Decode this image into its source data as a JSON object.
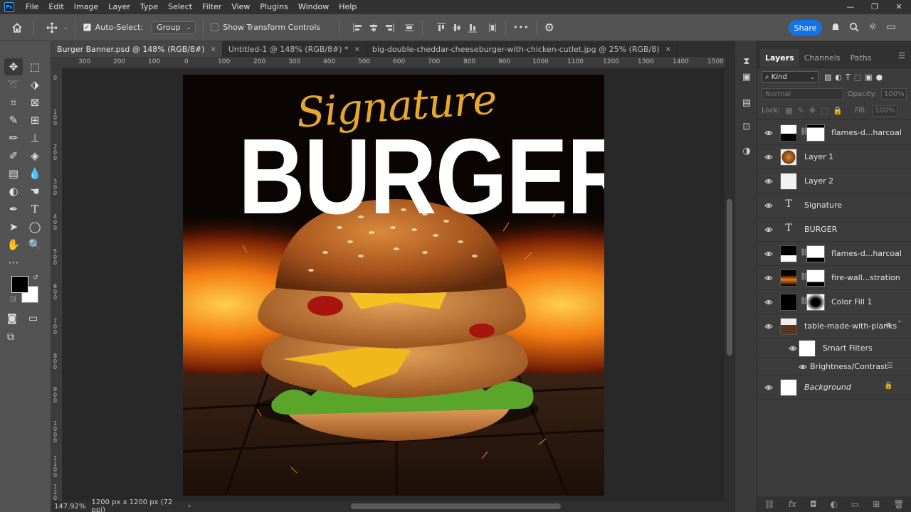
{
  "menu": [
    "File",
    "Edit",
    "Image",
    "Layer",
    "Type",
    "Select",
    "Filter",
    "View",
    "Plugins",
    "Window",
    "Help"
  ],
  "options": {
    "auto_select_label": "Auto-Select:",
    "group_select": "Group",
    "transform_label": "Show Transform Controls",
    "more_label": "•••",
    "share_label": "Share"
  },
  "tabs": [
    {
      "label": "Burger Banner.psd @ 148% (RGB/8#)",
      "active": true
    },
    {
      "label": "Untitled-1 @ 148% (RGB/8#) *",
      "active": false
    },
    {
      "label": "big-double-cheddar-cheeseburger-with-chicken-cutlet.jpg @ 25% (RGB/8)",
      "active": false
    }
  ],
  "ruler_h": [
    "300",
    "200",
    "100",
    "0",
    "100",
    "200",
    "300",
    "400",
    "500",
    "600",
    "700",
    "800",
    "900",
    "1000",
    "1100",
    "1200",
    "1300",
    "1400",
    "1500"
  ],
  "ruler_v": [
    "0",
    "100",
    "200",
    "300",
    "400",
    "500",
    "600",
    "700",
    "800",
    "900",
    "1000",
    "1100",
    "1200"
  ],
  "artwork": {
    "signature": "Signature",
    "headline": "BURGER"
  },
  "status": {
    "zoom": "147.92%",
    "doc_size": "1200 px x 1200 px (72 ppi)"
  },
  "panel": {
    "tabs": [
      "Layers",
      "Channels",
      "Paths"
    ],
    "kind_label": "Kind",
    "blend_mode": "Normal",
    "opacity_label": "Opacity:",
    "opacity_value": "100%",
    "lock_label": "Lock:",
    "fill_label": "Fill:",
    "fill_value": "100%"
  },
  "layers": [
    {
      "name": "flames-d...harcoal",
      "type": "smart-mask"
    },
    {
      "name": "Layer 1",
      "type": "smart"
    },
    {
      "name": "Layer 2",
      "type": "pixel"
    },
    {
      "name": "Signature",
      "type": "text"
    },
    {
      "name": "BURGER",
      "type": "text"
    },
    {
      "name": "flames-d...harcoal",
      "type": "smart-mask"
    },
    {
      "name": "fire-wall...stration",
      "type": "smart-mask"
    },
    {
      "name": "Color Fill 1",
      "type": "fill-mask"
    },
    {
      "name": "table-made-with-planks",
      "type": "smart-filters"
    },
    {
      "name": "Smart Filters",
      "type": "sub"
    },
    {
      "name": "Brightness/Contrast",
      "type": "filter"
    },
    {
      "name": "Background",
      "type": "background"
    }
  ],
  "colors": {
    "accent": "#1473e6",
    "foreground": "#000000",
    "background": "#ffffff",
    "signature": "#e6a72a"
  }
}
